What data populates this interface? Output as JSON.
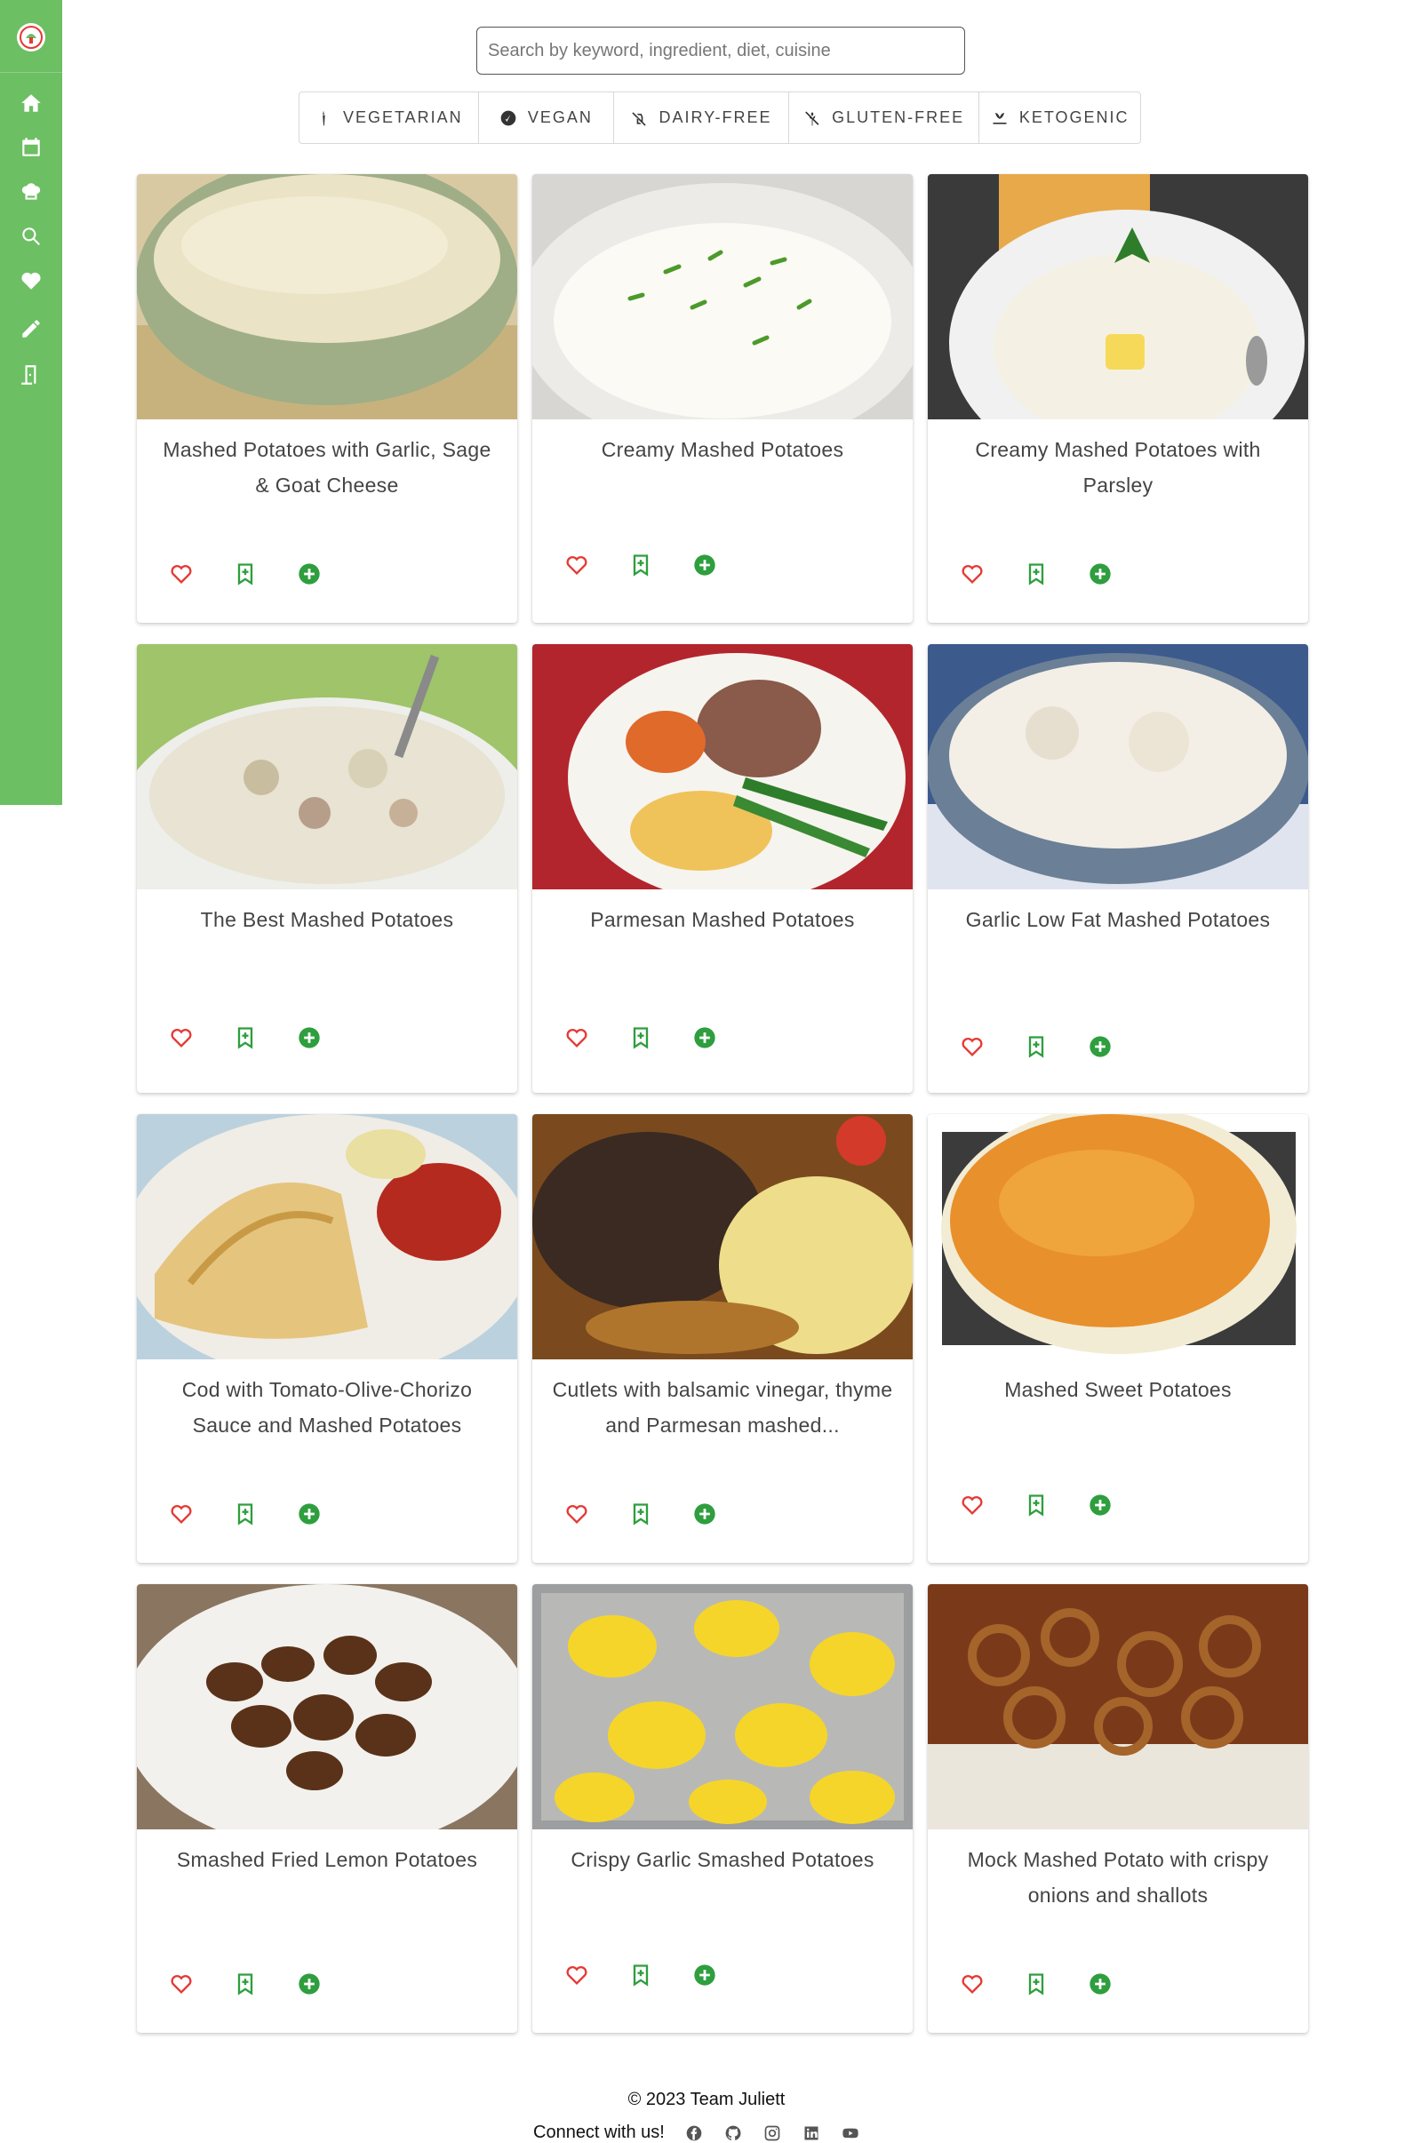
{
  "colors": {
    "sidebar": "#6cbf63",
    "heart": "#e53935",
    "bookmark": "#2e9e3e",
    "add": "#2e9e3e"
  },
  "sidebar": {
    "logo": "chef-logo-icon",
    "items": [
      {
        "icon": "home-icon"
      },
      {
        "icon": "calendar-icon"
      },
      {
        "icon": "chef-hat-icon"
      },
      {
        "icon": "search-icon"
      },
      {
        "icon": "heart-icon"
      },
      {
        "icon": "pencil-icon"
      },
      {
        "icon": "logout-icon"
      }
    ]
  },
  "search": {
    "placeholder": "Search by keyword, ingredient, diet, cuisine",
    "value": ""
  },
  "diets": [
    {
      "label": "VEGETARIAN",
      "icon": "carrot-icon"
    },
    {
      "label": "VEGAN",
      "icon": "vegan-icon"
    },
    {
      "label": "DAIRY-FREE",
      "icon": "dairy-free-icon"
    },
    {
      "label": "GLUTEN-FREE",
      "icon": "gluten-free-icon"
    },
    {
      "label": "KETOGENIC",
      "icon": "keto-icon"
    }
  ],
  "recipes": [
    {
      "title": "Mashed Potatoes with Garlic, Sage & Goat Cheese"
    },
    {
      "title": "Creamy Mashed Potatoes"
    },
    {
      "title": "Creamy Mashed Potatoes with Parsley"
    },
    {
      "title": "The Best Mashed Potatoes"
    },
    {
      "title": "Parmesan Mashed Potatoes"
    },
    {
      "title": "Garlic Low Fat Mashed Potatoes"
    },
    {
      "title": "Cod with Tomato-Olive-Chorizo Sauce and Mashed Potatoes"
    },
    {
      "title": "Cutlets with balsamic vinegar, thyme and Parmesan mashed..."
    },
    {
      "title": "Mashed Sweet Potatoes"
    },
    {
      "title": "Smashed Fried Lemon Potatoes"
    },
    {
      "title": "Crispy Garlic Smashed Potatoes"
    },
    {
      "title": "Mock Mashed Potato with crispy onions and shallots"
    }
  ],
  "footer": {
    "copyright": "© 2023 Team Juliett",
    "connect": "Connect with us!",
    "socials": [
      "facebook-icon",
      "github-icon",
      "instagram-icon",
      "linkedin-icon",
      "youtube-icon"
    ]
  }
}
